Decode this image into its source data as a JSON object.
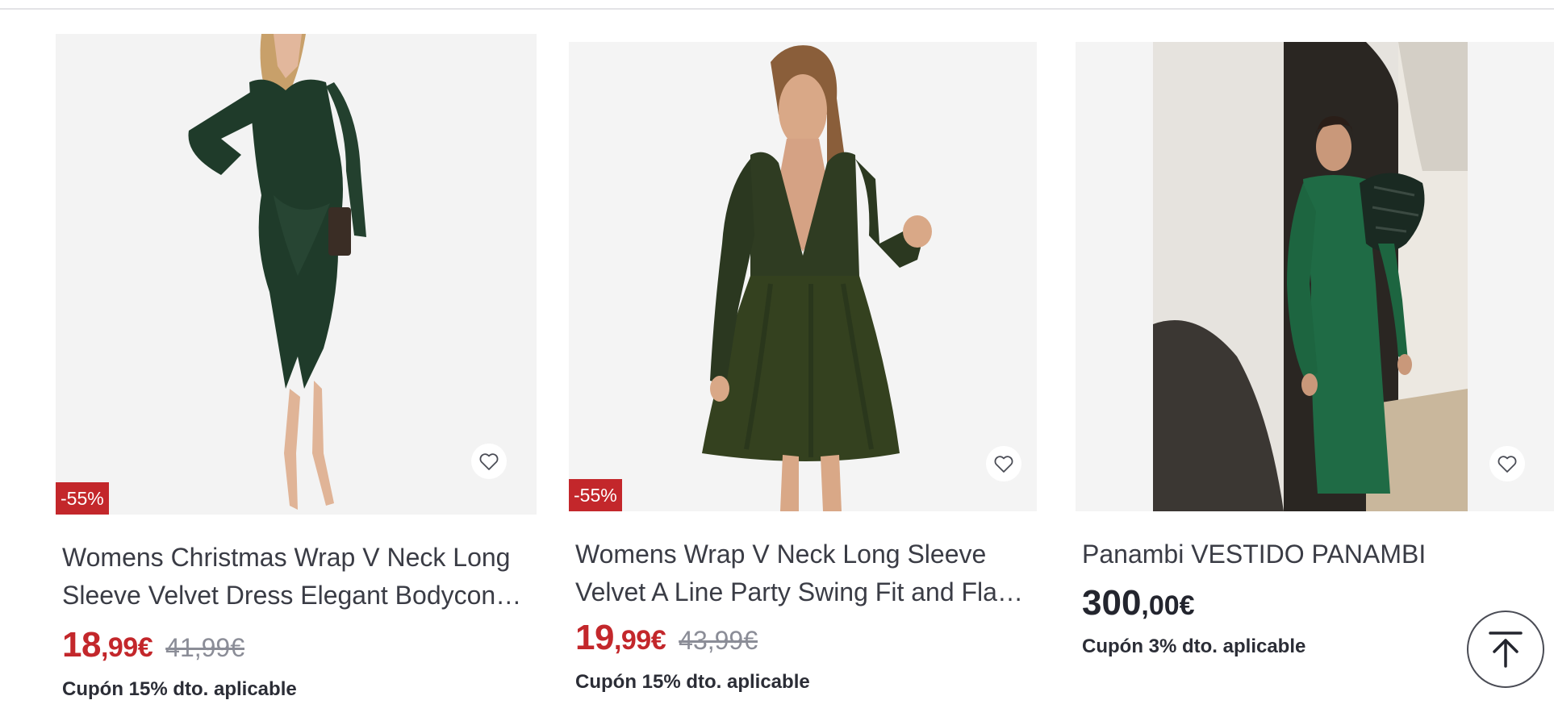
{
  "products": [
    {
      "badge": "-55%",
      "title": "Womens Christmas Wrap V Neck Long Sleeve Velvet Dress Elegant Bodycon Midi Dress",
      "price_int": "18",
      "price_dec": ",99€",
      "old_price": "41,99€",
      "coupon": "Cupón 15% dto. aplicable"
    },
    {
      "badge": "-55%",
      "title": "Womens Wrap V Neck Long Sleeve Velvet A Line Party Swing Fit and Flare Dress",
      "price_int": "19",
      "price_dec": ",99€",
      "old_price": "43,99€",
      "coupon": "Cupón 15% dto. aplicable"
    },
    {
      "title": "Panambi VESTIDO PANAMBI",
      "price_int": "300",
      "price_dec": ",00€",
      "coupon": "Cupón 3% dto. aplicable"
    }
  ],
  "icons": {
    "favorite": "heart-outline-icon",
    "scroll_top": "arrow-up-to-top-icon"
  },
  "colors": {
    "sale": "#c3272b",
    "dress_green_dark": "#1f3b2a",
    "dress_green_olive": "#2f3c22",
    "dress_green_emerald": "#1f6b45"
  }
}
